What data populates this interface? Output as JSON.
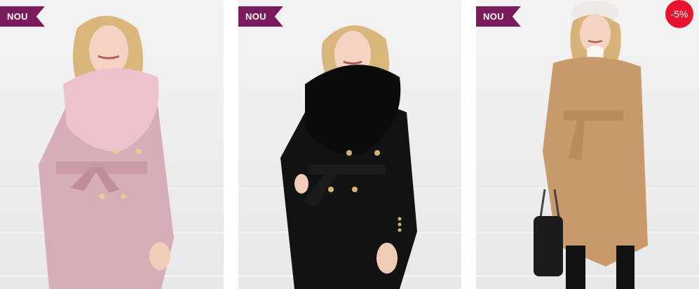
{
  "products": [
    {
      "badge": "NOU",
      "image_icon": "woman-pink-coat-fur-collar",
      "coat_color": "#d7adb8",
      "fur_color": "#eec2cc"
    },
    {
      "badge": "NOU",
      "image_icon": "woman-black-coat-fur-collar",
      "coat_color": "#121212",
      "fur_color": "#0b0b0b"
    },
    {
      "badge": "NOU",
      "discount": "-5%",
      "image_icon": "woman-camel-coat-belted",
      "coat_color": "#c89a6b"
    }
  ],
  "colors": {
    "badge_bg": "#7a1c5c",
    "discount_bg": "#e8132f"
  }
}
